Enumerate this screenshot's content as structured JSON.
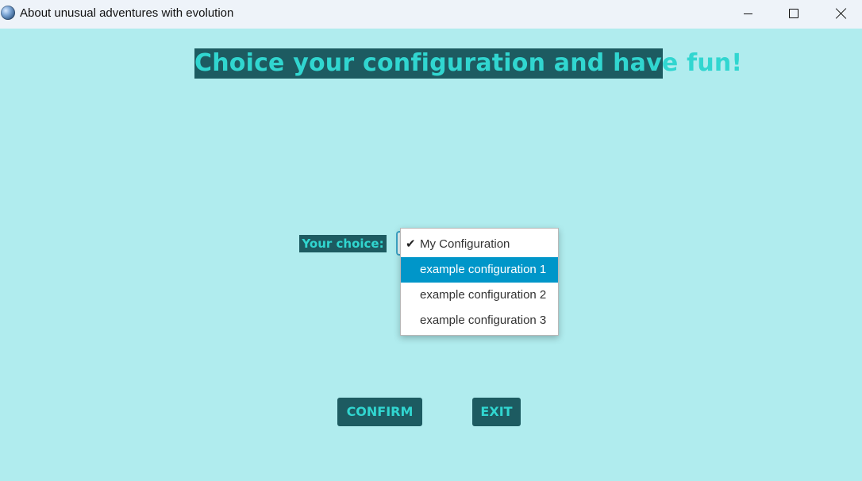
{
  "window": {
    "title": "About unusual adventures with evolution",
    "icon": "globe-icon"
  },
  "main": {
    "heading": "Choice your configuration and have fun!",
    "choice_label": "Your choice:",
    "dropdown": {
      "selected": "My Configuration",
      "highlighted": "example configuration 1",
      "options": [
        {
          "label": "My Configuration",
          "checked": true
        },
        {
          "label": "example configuration 1",
          "checked": false
        },
        {
          "label": "example configuration 2",
          "checked": false
        },
        {
          "label": "example configuration 3",
          "checked": false
        }
      ]
    },
    "confirm_label": "CONFIRM",
    "exit_label": "EXIT"
  },
  "colors": {
    "background": "#b0ecee",
    "panel": "#1d5b61",
    "accent_text": "#31d6d0",
    "highlight": "#0096c9"
  }
}
